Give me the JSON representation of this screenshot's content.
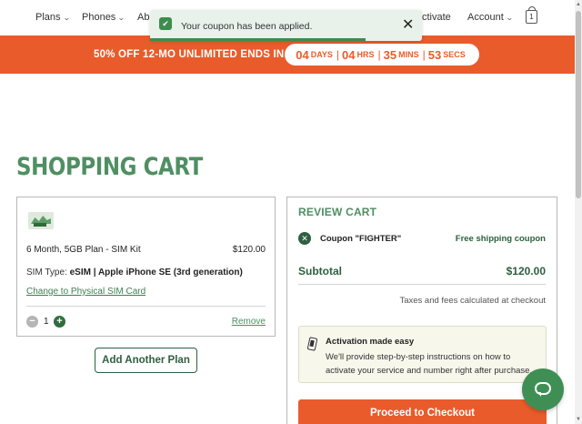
{
  "nav": {
    "items": [
      {
        "label": "Plans"
      },
      {
        "label": "Phones"
      },
      {
        "label": "Abo"
      },
      {
        "label": "ctivate"
      },
      {
        "label": "Account"
      }
    ],
    "cart_count": "1"
  },
  "toast": {
    "message": "Your coupon has been applied.",
    "close": "✕"
  },
  "promo": {
    "text": "50% OFF 12-MO UNLIMITED ENDS IN",
    "days_num": "04",
    "days_unit": "DAYS",
    "hrs_num": "04",
    "hrs_unit": "HRS",
    "mins_num": "35",
    "mins_unit": "MINS",
    "secs_num": "53",
    "secs_unit": "SECS"
  },
  "page_title": "SHOPPING CART",
  "cart_item": {
    "name": "6 Month, 5GB Plan - SIM Kit",
    "price": "$120.00",
    "sim_type_label": "SIM Type:",
    "sim_type_value": "eSIM | Apple iPhone SE (3rd generation)",
    "change_link": "Change to Physical SIM Card",
    "quantity": "1",
    "minus": "−",
    "plus": "+",
    "remove": "Remove"
  },
  "add_plan": "Add Another Plan",
  "review": {
    "title": "REVIEW CART",
    "coupon_label": "Coupon \"FIGHTER\"",
    "coupon_desc": "Free shipping coupon",
    "subtotal_label": "Subtotal",
    "subtotal_value": "$120.00",
    "taxes_note": "Taxes and fees calculated at checkout",
    "activation_title": "Activation made easy",
    "activation_body": "We'll provide step-by-step instructions on how to activate your service and number right after purchase.",
    "checkout": "Proceed to Checkout"
  },
  "colors": {
    "brand_green": "#4f8f62",
    "dark_green": "#2f5f40",
    "promo_orange": "#ea5b2b"
  }
}
